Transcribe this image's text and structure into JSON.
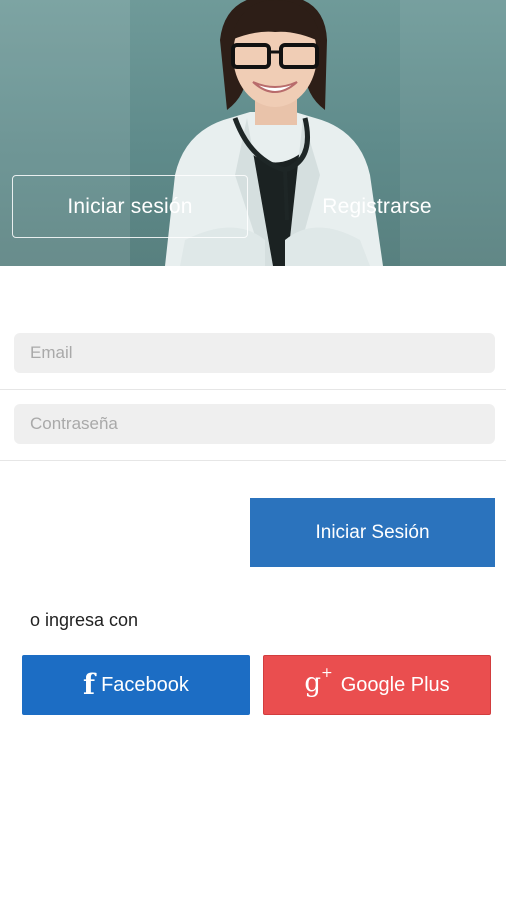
{
  "tabs": {
    "login_label": "Iniciar sesión",
    "register_label": "Registrarse"
  },
  "form": {
    "email_placeholder": "Email",
    "password_placeholder": "Contraseña",
    "submit_label": "Iniciar Sesión"
  },
  "social": {
    "intro_text": "o ingresa con",
    "facebook_label": "Facebook",
    "facebook_icon": "facebook-f-icon",
    "google_label": "Google Plus",
    "google_icon": "google-plus-icon"
  },
  "colors": {
    "primary_blue": "#2b73bd",
    "facebook_blue": "#1c6dc4",
    "google_red": "#ea4e4f",
    "field_bg": "#efefef"
  }
}
